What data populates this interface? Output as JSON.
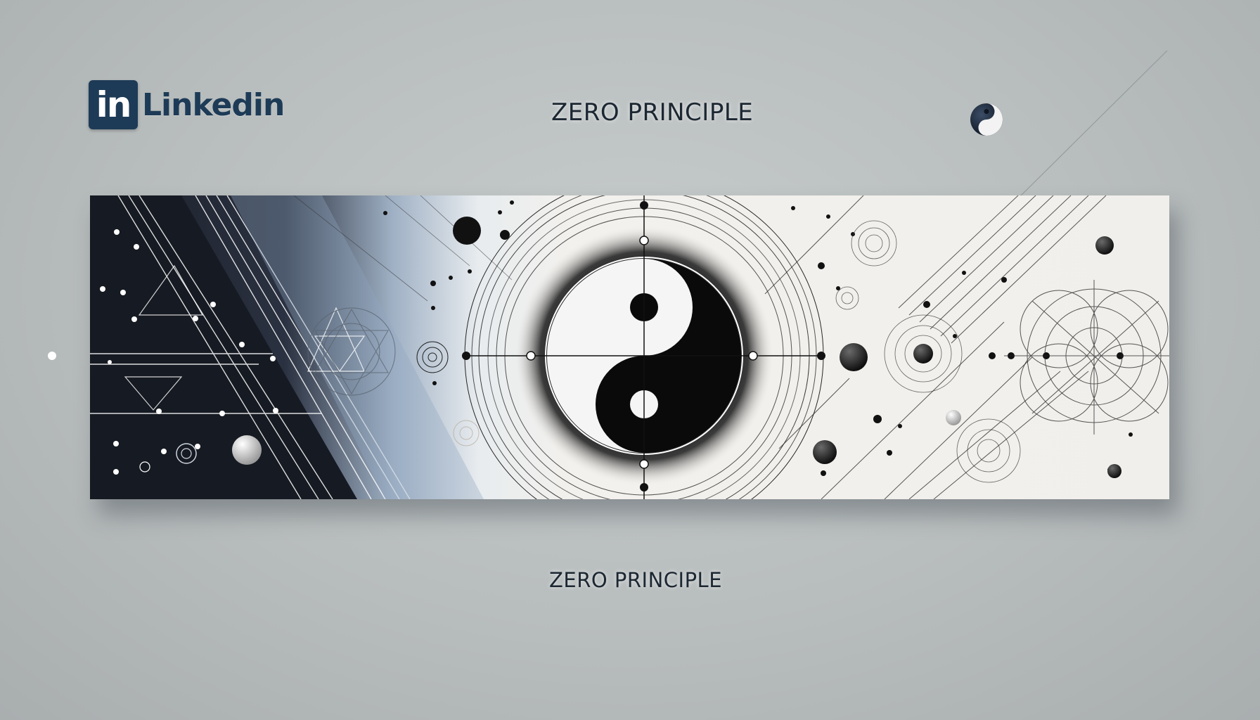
{
  "brand": {
    "badge_text": "in",
    "wordmark": "Linkedin",
    "color": "#1d3b57"
  },
  "headline": "ZERO PRINCIPLE",
  "footer_title": "ZERO PRINCIPLE",
  "icons": {
    "small_symbol": "yin-yang-icon",
    "banner_center": "yin-yang-icon"
  },
  "colors": {
    "background": "#bcc1c1",
    "banner_dark": "#1a1e27",
    "banner_light": "#f1efeb",
    "ink": "#111111"
  }
}
